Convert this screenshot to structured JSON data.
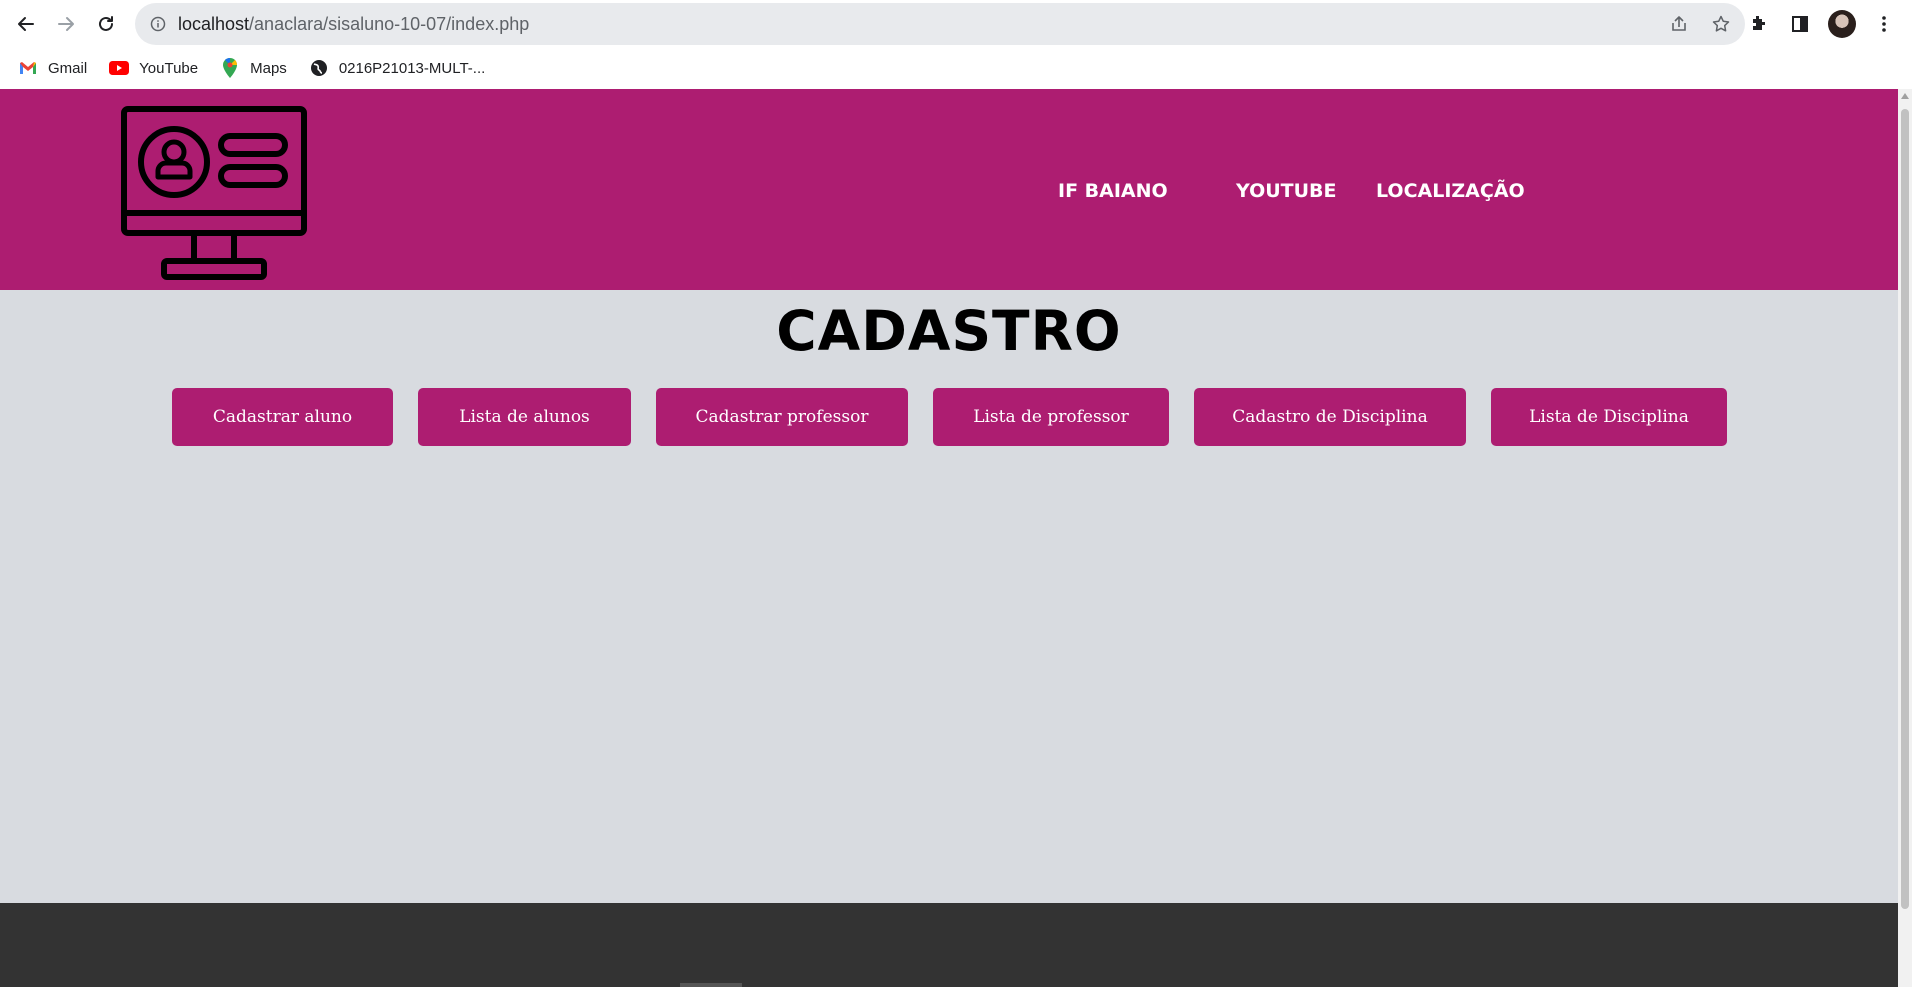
{
  "browser": {
    "url_host": "localhost",
    "url_path": "/anaclara/sisaluno-10-07/index.php",
    "bookmarks": [
      {
        "label": "Gmail",
        "icon": "gmail-icon"
      },
      {
        "label": "YouTube",
        "icon": "youtube-icon"
      },
      {
        "label": "Maps",
        "icon": "maps-icon"
      },
      {
        "label": "0216P21013-MULT-...",
        "icon": "globe-icon"
      }
    ]
  },
  "header": {
    "logo_icon": "computer-user-profile-icon",
    "nav": [
      "IF BAIANO",
      "YOUTUBE",
      "LOCALIZAÇÃO"
    ]
  },
  "main": {
    "title": "CADASTRO",
    "buttons": [
      "Cadastrar aluno",
      "Lista de alunos",
      "Cadastrar professor",
      "Lista de professor",
      "Cadastro de Disciplina",
      "Lista de Disciplina"
    ]
  },
  "colors": {
    "brand": "#ad1d71",
    "page_bg": "#d8dbe0",
    "footer_bg": "#333333"
  }
}
